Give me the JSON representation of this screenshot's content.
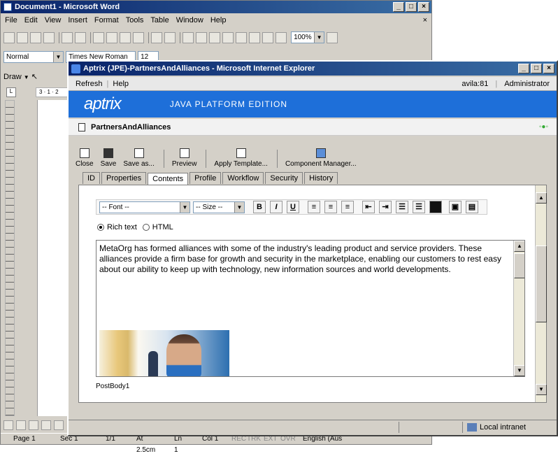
{
  "word": {
    "title": "Document1 - Microsoft Word",
    "menu": [
      "File",
      "Edit",
      "View",
      "Insert",
      "Format",
      "Tools",
      "Table",
      "Window",
      "Help"
    ],
    "zoom": "100%",
    "style": "Normal",
    "font_partial": "Times New Roman",
    "size_partial": "12",
    "draw": "Draw",
    "ruler_partial": "3 · 1 · 2",
    "status": {
      "page": "Page 1",
      "sec": "Sec 1",
      "pages": "1/1",
      "at": "At 2.5cm",
      "ln": "Ln 1",
      "col": "Col 1",
      "rec": "REC",
      "trk": "TRK",
      "ext": "EXT",
      "ovr": "OVR",
      "lang": "English (Aus"
    }
  },
  "ie": {
    "title": "Aptrix (JPE)-PartnersAndAlliances - Microsoft Internet Explorer",
    "menu": {
      "refresh": "Refresh",
      "help": "Help"
    },
    "user": "avila:81",
    "role": "Administrator",
    "logo": "aptrix",
    "edition": "JAVA PLATFORM EDITION",
    "page_title": "PartnersAndAlliances",
    "toolbar": [
      "Close",
      "Save",
      "Save as...",
      "Preview",
      "Apply Template...",
      "Component Manager..."
    ],
    "tabs": [
      "ID",
      "Properties",
      "Contents",
      "Profile",
      "Workflow",
      "Security",
      "History"
    ],
    "editor": {
      "font": "-- Font --",
      "size": "-- Size --",
      "bold": "B",
      "italic": "I",
      "underline": "U",
      "mode_rich": "Rich text",
      "mode_html": "HTML",
      "body": "MetaOrg has formed alliances with some of the industry's leading product and service providers. These alliances provide a firm base for growth and security in the marketplace, enabling our customers to rest easy about our ability to keep up with technology, new information sources and world developments.",
      "field_label": "PostBody1"
    },
    "status_zone": "Local intranet"
  },
  "colors": {
    "titlebar": "#0a246a",
    "brand_bar": "#1e6fd9",
    "chrome": "#d4d0c8"
  }
}
